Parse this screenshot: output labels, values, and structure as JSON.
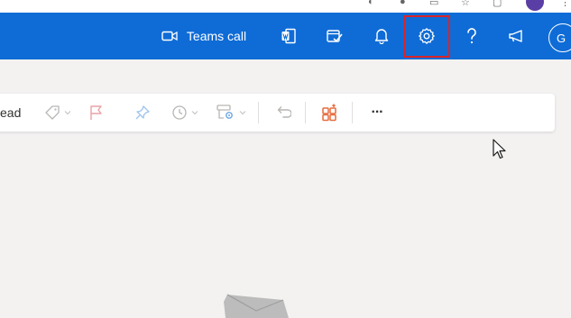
{
  "header": {
    "teams_call_label": "Teams call",
    "avatar_initial": "G",
    "brand_color": "#0f6cd6"
  },
  "toolbar": {
    "read_label": "ead",
    "more_label": "···"
  },
  "highlight": {
    "color": "#d9252a",
    "target": "settings-button"
  }
}
